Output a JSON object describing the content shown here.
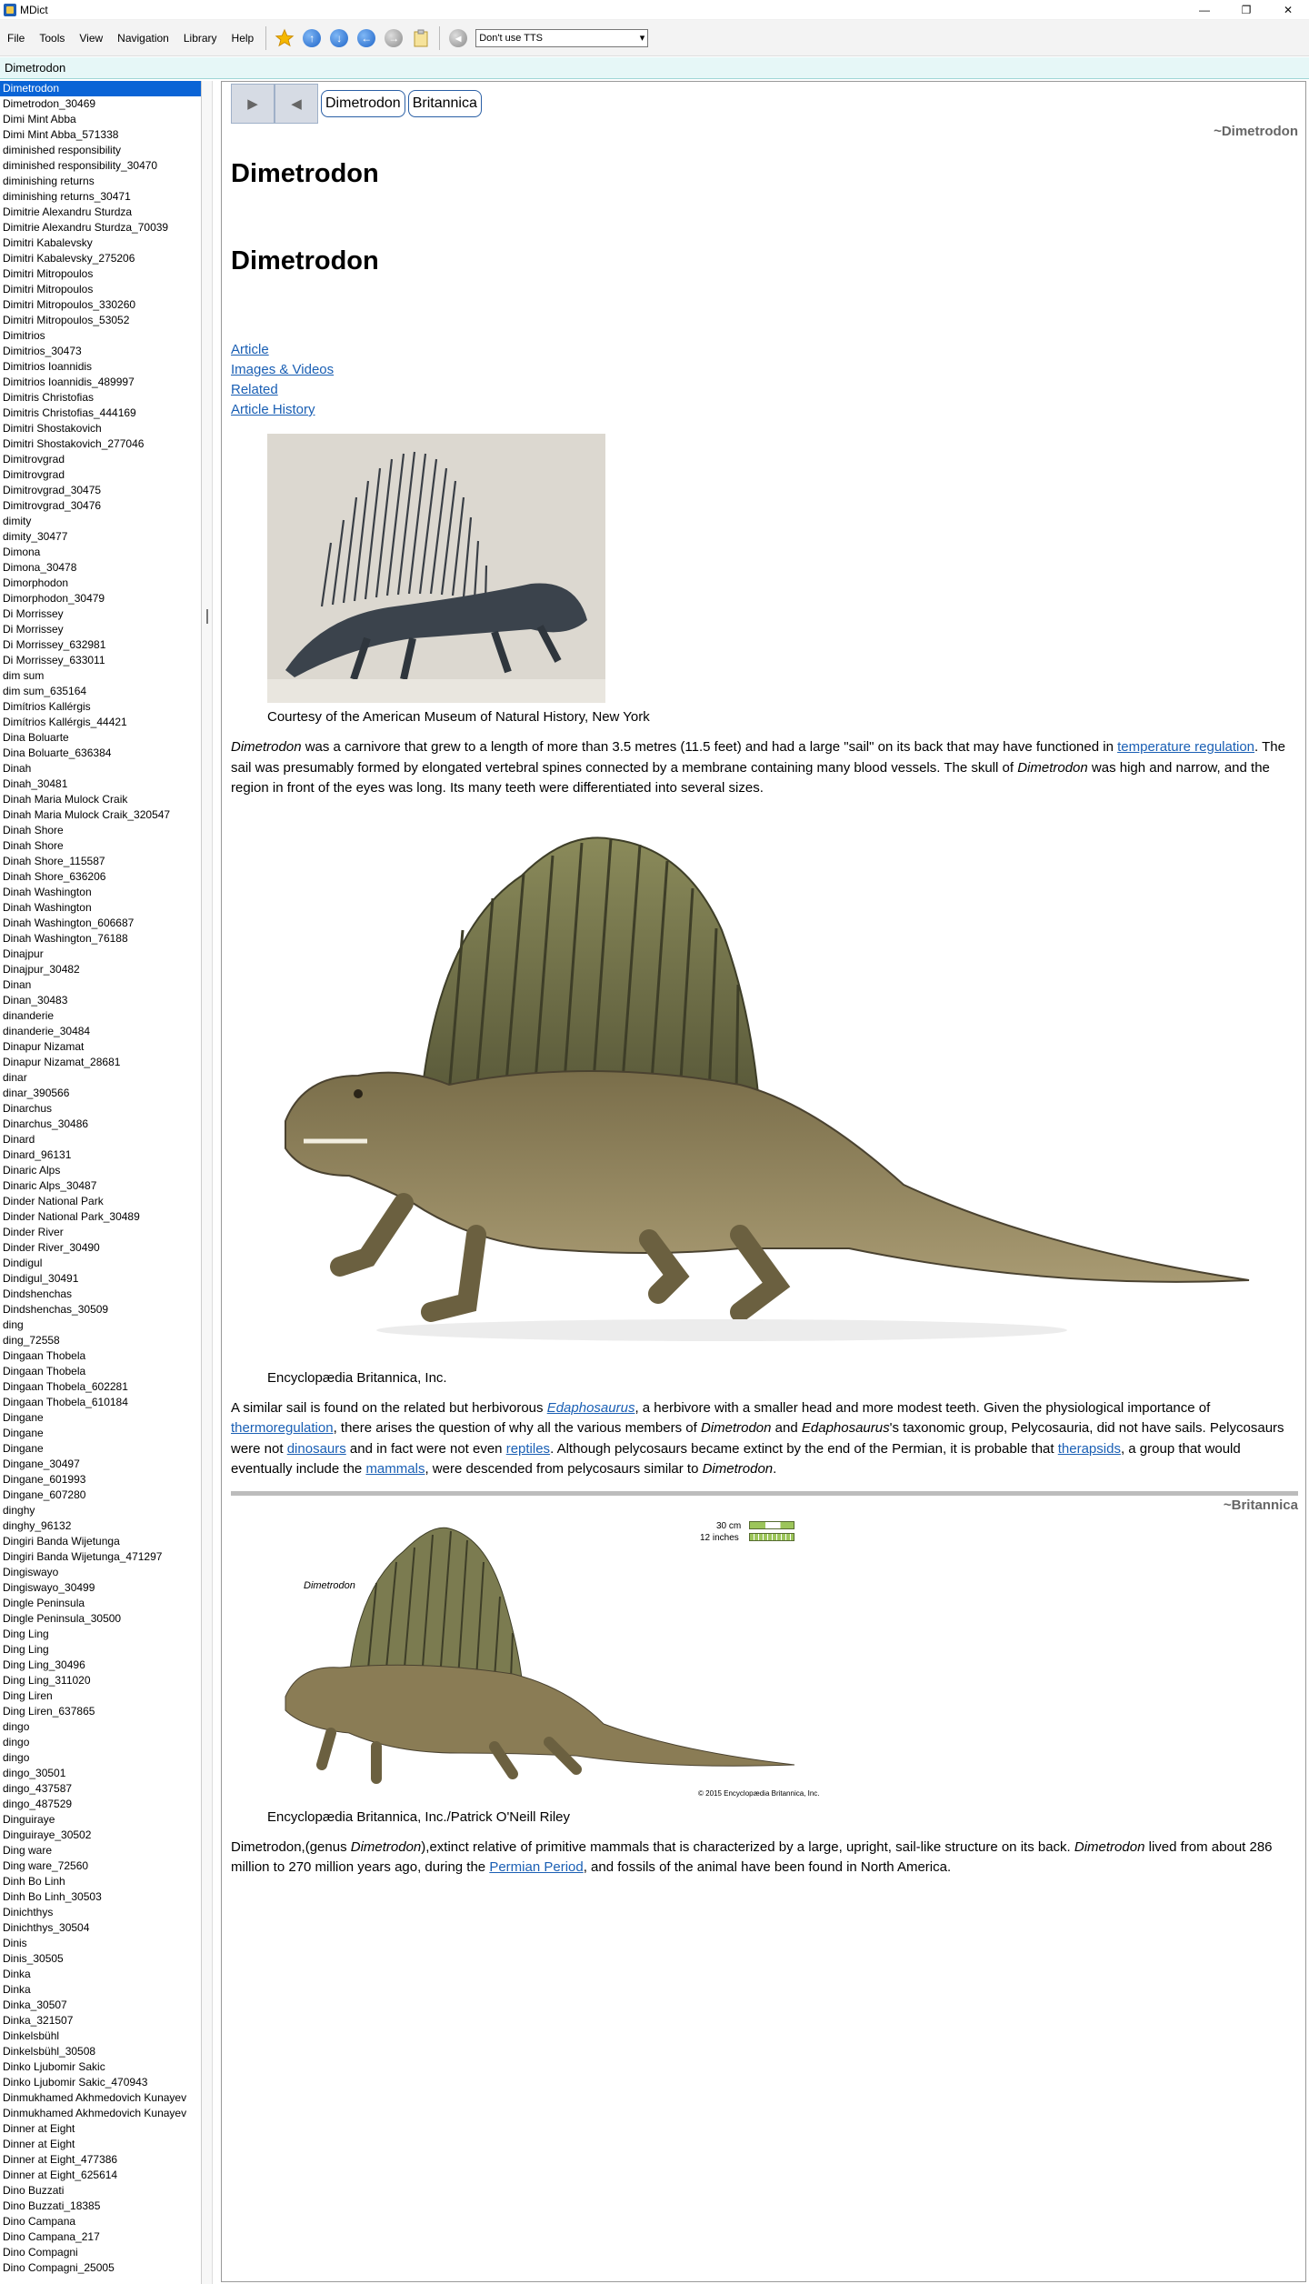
{
  "window": {
    "title": "MDict",
    "controls": [
      "—",
      "❐",
      "✕"
    ]
  },
  "menu": [
    "File",
    "Tools",
    "View",
    "Navigation",
    "Library",
    "Help"
  ],
  "toolbar": {
    "icons": [
      "star-icon",
      "back-circle-icon",
      "forward-circle-icon",
      "history-back-icon",
      "history-forward-icon",
      "clipboard-icon"
    ],
    "tts_icon": "speaker-icon",
    "tts_value": "Don't use TTS"
  },
  "search": {
    "value": "Dimetrodon"
  },
  "sidebar": {
    "selected_index": 0,
    "items": [
      "Dimetrodon",
      "Dimetrodon_30469",
      "Dimi Mint Abba",
      "Dimi Mint Abba_571338",
      "diminished responsibility",
      "diminished responsibility_30470",
      "diminishing returns",
      "diminishing returns_30471",
      "Dimitrie Alexandru Sturdza",
      "Dimitrie Alexandru Sturdza_70039",
      "Dimitri Kabalevsky",
      "Dimitri Kabalevsky_275206",
      "Dimitri Mitropoulos",
      "Dimitri Mitropoulos",
      "Dimitri Mitropoulos_330260",
      "Dimitri Mitropoulos_53052",
      "Dimitrios",
      "Dimitrios_30473",
      "Dimitrios Ioannidis",
      "Dimitrios Ioannidis_489997",
      "Dimitris Christofias",
      "Dimitris Christofias_444169",
      "Dimitri Shostakovich",
      "Dimitri Shostakovich_277046",
      "Dimitrovgrad",
      "Dimitrovgrad",
      "Dimitrovgrad_30475",
      "Dimitrovgrad_30476",
      "dimity",
      "dimity_30477",
      "Dimona",
      "Dimona_30478",
      "Dimorphodon",
      "Dimorphodon_30479",
      "Di Morrissey",
      "Di Morrissey",
      "Di Morrissey_632981",
      "Di Morrissey_633011",
      "dim sum",
      "dim sum_635164",
      "Dimítrios Kallérgis",
      "Dimítrios Kallérgis_44421",
      "Dina Boluarte",
      "Dina Boluarte_636384",
      "Dinah",
      "Dinah_30481",
      "Dinah Maria Mulock Craik",
      "Dinah Maria Mulock Craik_320547",
      "Dinah Shore",
      "Dinah Shore",
      "Dinah Shore_115587",
      "Dinah Shore_636206",
      "Dinah Washington",
      "Dinah Washington",
      "Dinah Washington_606687",
      "Dinah Washington_76188",
      "Dinajpur",
      "Dinajpur_30482",
      "Dinan",
      "Dinan_30483",
      "dinanderie",
      "dinanderie_30484",
      "Dinapur Nizamat",
      "Dinapur Nizamat_28681",
      "dinar",
      "dinar_390566",
      "Dinarchus",
      "Dinarchus_30486",
      "Dinard",
      "Dinard_96131",
      "Dinaric Alps",
      "Dinaric Alps_30487",
      "Dinder National Park",
      "Dinder National Park_30489",
      "Dinder River",
      "Dinder River_30490",
      "Dindigul",
      "Dindigul_30491",
      "Dindshenchas",
      "Dindshenchas_30509",
      "ding",
      "ding_72558",
      "Dingaan Thobela",
      "Dingaan Thobela",
      "Dingaan Thobela_602281",
      "Dingaan Thobela_610184",
      "Dingane",
      "Dingane",
      "Dingane",
      "Dingane_30497",
      "Dingane_601993",
      "Dingane_607280",
      "dinghy",
      "dinghy_96132",
      "Dingiri Banda Wijetunga",
      "Dingiri Banda Wijetunga_471297",
      "Dingiswayo",
      "Dingiswayo_30499",
      "Dingle Peninsula",
      "Dingle Peninsula_30500",
      "Ding Ling",
      "Ding Ling",
      "Ding Ling_30496",
      "Ding Ling_311020",
      "Ding Liren",
      "Ding Liren_637865",
      "dingo",
      "dingo",
      "dingo",
      "dingo_30501",
      "dingo_437587",
      "dingo_487529",
      "Dinguiraye",
      "Dinguiraye_30502",
      "Ding ware",
      "Ding ware_72560",
      "Dinh Bo Linh",
      "Dinh Bo Linh_30503",
      "Dinichthys",
      "Dinichthys_30504",
      "Dinis",
      "Dinis_30505",
      "Dinka",
      "Dinka",
      "Dinka_30507",
      "Dinka_321507",
      "Dinkelsbühl",
      "Dinkelsbühl_30508",
      "Dinko Ljubomir Sakic",
      "Dinko Ljubomir Sakic_470943",
      "Dinmukhamed Akhmedovich Kunayev",
      "Dinmukhamed Akhmedovich Kunayev",
      "Dinner at Eight",
      "Dinner at Eight",
      "Dinner at Eight_477386",
      "Dinner at Eight_625614",
      "Dino Buzzati",
      "Dino Buzzati_18385",
      "Dino Campana",
      "Dino Campana_217",
      "Dino Compagni",
      "Dino Compagni_25005"
    ]
  },
  "content": {
    "nav_back": "▶",
    "nav_forward": "◀",
    "dict_tabs": [
      "Dimetrodon",
      "Britannica"
    ],
    "source_tag_1": "~Dimetrodon",
    "heading_1": "Dimetrodon",
    "heading_2": "Dimetrodon",
    "links": [
      "Article",
      "Images & Videos",
      "Related",
      "Article History"
    ],
    "image1_caption": "Courtesy of the American Museum of Natural History, New York",
    "para1": {
      "i1": "Dimetrodon",
      "t1": " was a carnivore that grew to a length of more than 3.5 metres (11.5 feet) and had a large \"sail\" on its back that may have functioned in ",
      "l1": "temperature regulation",
      "t2": ". The sail was presumably formed by elongated vertebral spines connected by a membrane containing many blood vessels. The skull of ",
      "i2": "Dimetrodon",
      "t3": " was high and narrow, and the region in front of the eyes was long. Its many teeth were differentiated into several sizes."
    },
    "image2_caption": "Encyclopædia Britannica, Inc.",
    "para2": {
      "t1": "A similar sail is found on the related but herbivorous ",
      "l1": "Edaphosaurus",
      "t2": ", a herbivore with a smaller head and more modest teeth. Given the physiological importance of ",
      "l2": "thermoregulation",
      "t3": ", there arises the question of why all the various members of ",
      "i1": "Dimetrodon",
      "t4": " and ",
      "i2": "Edaphosaurus",
      "t5": "'s taxonomic group, Pelycosauria, did not have sails. Pelycosaurs were not ",
      "l3": "dinosaurs",
      "t6": " and in fact were not even ",
      "l4": "reptiles",
      "t7": ". Although pelycosaurs became extinct by the end of the Permian, it is probable that ",
      "l5": "therapsids",
      "t8": ", a group that would eventually include the ",
      "l6": "mammals",
      "t9": ", were descended from pelycosaurs similar to ",
      "i3": "Dimetrodon",
      "t10": "."
    },
    "source_tag_2": "~Britannica",
    "image3_label": "Dimetrodon",
    "image3_scale_cm": "30 cm",
    "image3_scale_in": "12 inches",
    "image3_copyright": "© 2015 Encyclopædia Britannica, Inc.",
    "image3_caption": "Encyclopædia Britannica, Inc./Patrick O'Neill Riley",
    "para3": {
      "t1": "Dimetrodon,(genus ",
      "i1": "Dimetrodon",
      "t2": "),extinct relative of primitive mammals that is characterized by a large, upright, sail-like structure on its back. ",
      "i2": "Dimetrodon",
      "t3": " lived from about 286 million to 270 million years ago, during the ",
      "l1": "Permian Period",
      "t4": ", and fossils of the animal have been found in North America."
    }
  }
}
